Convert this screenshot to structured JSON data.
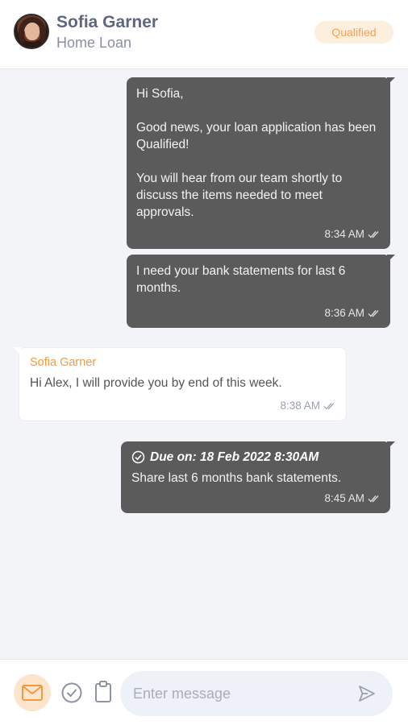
{
  "header": {
    "name": "Sofia Garner",
    "subtitle": "Home Loan",
    "status": "Qualified"
  },
  "messages": [
    {
      "direction": "outgoing",
      "text": "Hi Sofia,\n\nGood news, your loan application has been Qualified!\n\nYou will hear from our team shortly to discuss the items needed to meet approvals.",
      "time": "8:34 AM"
    },
    {
      "direction": "outgoing",
      "text": "I need your bank statements for last 6 months.",
      "time": "8:36 AM"
    },
    {
      "direction": "incoming",
      "sender": "Sofia Garner",
      "text": "Hi Alex, I will provide you by end of this week.",
      "time": "8:38 AM"
    },
    {
      "direction": "outgoing",
      "task_due": "Due on: 18 Feb 2022 8:30AM",
      "text": "Share last 6 months bank statements.",
      "time": "8:45 AM"
    }
  ],
  "composer": {
    "placeholder": "Enter message",
    "value": ""
  },
  "icons": {
    "mail": "mail-icon",
    "task": "check-circle-icon",
    "clipboard": "clipboard-icon",
    "send": "send-icon",
    "read": "double-check-icon"
  },
  "colors": {
    "accent": "#f4a356",
    "outgoing_bubble": "#5b5b5b",
    "incoming_bubble": "#ffffff",
    "background": "#f3f4f8"
  }
}
